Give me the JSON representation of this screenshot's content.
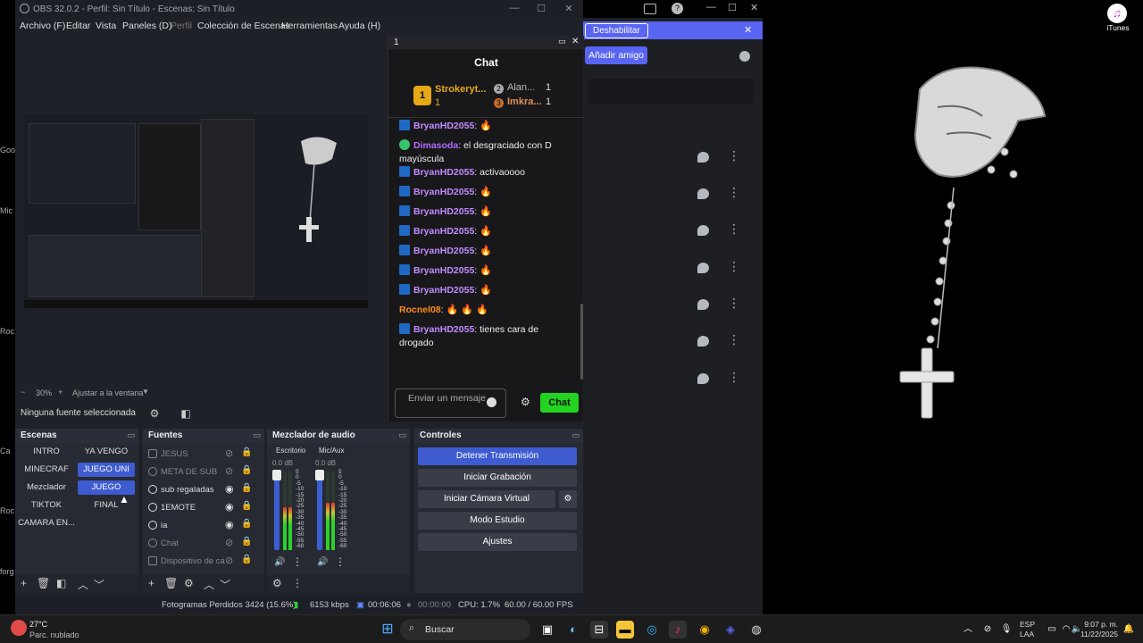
{
  "desktop": {
    "edge_labels": [
      "Goo",
      "Mic",
      "Roc",
      "Ca",
      "Roc",
      "forg"
    ],
    "itunes_label": "iTunes"
  },
  "obs": {
    "title": "OBS 32.0.2 - Perfil: Sin Título - Escenas: Sin Título",
    "menu": [
      "Archivo (F)",
      "Editar",
      "Vista",
      "Paneles (D)",
      "Perfil",
      "Colección de Escenas",
      "Herramientas",
      "Ayuda (H)"
    ],
    "zoom": "30%",
    "fit_label": "Ajustar a la ventana",
    "no_source": "Ninguna fuente seleccionada",
    "docks": {
      "scenes_title": "Escenas",
      "sources_title": "Fuentes",
      "mixer_title": "Mezclador de audio",
      "controls_title": "Controles"
    },
    "scenes": [
      {
        "label": "INTRO",
        "active": false
      },
      {
        "label": "YA VENGO",
        "active": false
      },
      {
        "label": "MINECRAF",
        "active": false
      },
      {
        "label": "JUEGO UNI",
        "active": true
      },
      {
        "label": "Mezclador",
        "active": false
      },
      {
        "label": "JUEGO",
        "active": true
      },
      {
        "label": "TIKTOK",
        "active": false
      },
      {
        "label": "FINAL",
        "active": false
      },
      {
        "label": "CAMARA EN...",
        "active": false
      }
    ],
    "sources": [
      {
        "label": "JESUS",
        "visible": false
      },
      {
        "label": "META DE SUB",
        "visible": false
      },
      {
        "label": "sub regaladas",
        "visible": true
      },
      {
        "label": "1EMOTE",
        "visible": true
      },
      {
        "label": "ia",
        "visible": true
      },
      {
        "label": "Chat",
        "visible": false
      },
      {
        "label": "Dispositivo de ca",
        "visible": false
      }
    ],
    "mixer": [
      {
        "name": "Escritorio",
        "db": "0.0 dB",
        "level": 0.55
      },
      {
        "name": "Mic/Aux",
        "db": "0.0 dB",
        "level": 0.6
      }
    ],
    "meter_scale": [
      "5",
      "0",
      "-5",
      "-10",
      "-15",
      "-20",
      "-25",
      "-30",
      "-35",
      "-40",
      "-45",
      "-50",
      "-55",
      "-60"
    ],
    "controls": {
      "stop_stream": "Detener Transmisión",
      "start_record": "Iniciar Grabación",
      "virtual_cam": "Iniciar Cámara Virtual",
      "studio_mode": "Modo Estudio",
      "settings": "Ajustes"
    },
    "status": {
      "dropped": "Fotogramas Perdidos 3424 (15.6%)",
      "bitrate": "6153 kbps",
      "stream_time": "00:06:06",
      "rec_time": "00:00:00",
      "cpu": "CPU: 1.7%",
      "fps": "60.00 / 60.00 FPS"
    }
  },
  "chat": {
    "window_title": "1",
    "header": "Chat",
    "leaderboard": [
      {
        "rank": "1",
        "name": "Strokeryt...",
        "count": "1"
      },
      {
        "rank": "2",
        "name": "Alan...",
        "count": "1"
      },
      {
        "rank": "3",
        "name": "Imkra...",
        "count": "1"
      }
    ],
    "messages": [
      {
        "user": "BryanHD2055",
        "text": "🔥",
        "color": "#c28cff"
      },
      {
        "user": "Dimasoda",
        "text": "el desgraciado con D mayúscula",
        "color": "#b36bff"
      },
      {
        "user": "BryanHD2055",
        "text": "activaoooo",
        "color": "#c28cff"
      },
      {
        "user": "BryanHD2055",
        "text": "🔥",
        "color": "#c28cff"
      },
      {
        "user": "BryanHD2055",
        "text": "🔥",
        "color": "#c28cff"
      },
      {
        "user": "BryanHD2055",
        "text": "🔥",
        "color": "#c28cff"
      },
      {
        "user": "BryanHD2055",
        "text": "🔥",
        "color": "#c28cff"
      },
      {
        "user": "BryanHD2055",
        "text": "🔥",
        "color": "#c28cff"
      },
      {
        "user": "BryanHD2055",
        "text": "🔥",
        "color": "#c28cff"
      },
      {
        "user": "Rocnel08",
        "text": "🔥 🔥 🔥",
        "color": "#ff8c1a"
      },
      {
        "user": "BryanHD2055",
        "text": "tienes cara de drogado",
        "color": "#c28cff"
      }
    ],
    "input_placeholder": "Enviar un mensaje",
    "send_label": "Chat"
  },
  "discord": {
    "banner_label": "Deshabilitar",
    "add_friend": "Añadir amigo",
    "accent": "#5865f2"
  },
  "taskbar": {
    "temp": "27°C",
    "weather": "Parc. nublado",
    "search": "Buscar",
    "lang1": "ESP",
    "lang2": "LAA",
    "time": "9:07 p. m.",
    "date": "11/22/2025"
  }
}
